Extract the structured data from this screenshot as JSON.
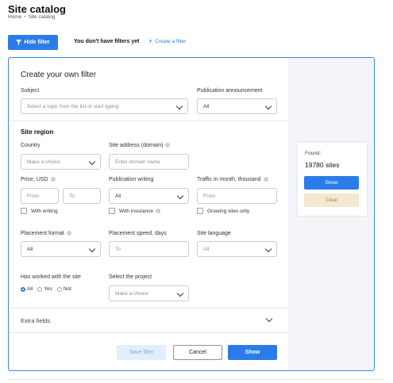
{
  "header": {
    "title": "Site catalog",
    "breadcrumb": [
      "Home",
      "Site catalog"
    ]
  },
  "toolbar": {
    "hide_filter_label": "Hide filter",
    "no_filters_text": "You don't have filters yet",
    "create_filter_label": "Create a filter"
  },
  "filter": {
    "title": "Create your own filter",
    "subject": {
      "label": "Subject",
      "placeholder": "Select a topic from the list or start typing"
    },
    "publication_announcement": {
      "label": "Publication announcement",
      "value": "All"
    },
    "site_region": {
      "title": "Site region",
      "country": {
        "label": "Country",
        "placeholder": "Make a choice"
      },
      "site_address": {
        "label": "Site address (domain)",
        "placeholder": "Enter domain name"
      },
      "price": {
        "label": "Price, USD",
        "from_placeholder": "From",
        "to_placeholder": "To",
        "checkbox_label": "With writing"
      },
      "publication_writing": {
        "label": "Publication writing",
        "value": "All",
        "checkbox_label": "With insurance"
      },
      "traffic": {
        "label": "Traffic in month, thousand",
        "from_placeholder": "From",
        "checkbox_label": "Growing sites only"
      },
      "placement_format": {
        "label": "Placement format",
        "value": "All"
      },
      "placement_speed": {
        "label": "Placement speed, days",
        "to_placeholder": "To"
      },
      "site_language": {
        "label": "Site language",
        "value": "All"
      },
      "has_worked": {
        "label": "Has worked with the site",
        "options": [
          "All",
          "Yes",
          "Not"
        ],
        "selected": "All"
      },
      "project": {
        "label": "Select the project",
        "placeholder": "Make a choice"
      }
    },
    "extra_fields_label": "Extra fields",
    "actions": {
      "save": "Save filter",
      "cancel": "Cancel",
      "show": "Show"
    }
  },
  "summary": {
    "found_label": "Found:",
    "count_text": "19780 sites",
    "show": "Show",
    "clear": "Clear"
  },
  "colors": {
    "accent": "#2b7ce9",
    "clear_bg": "#f5e8d0",
    "save_disabled_bg": "#e3eefc"
  }
}
